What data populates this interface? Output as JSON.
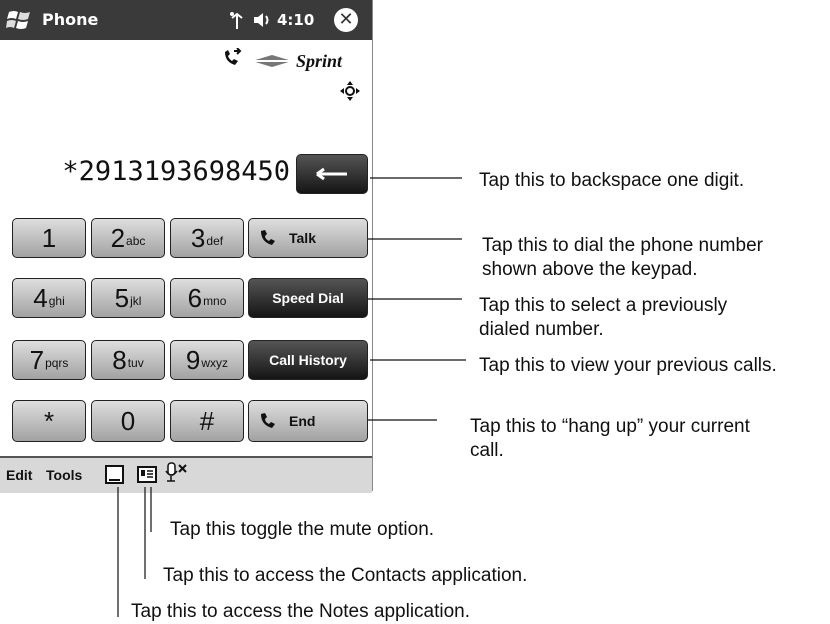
{
  "window": {
    "title": "Phone",
    "time": "4:10",
    "close_label": "✕",
    "carrier_logo": "Sprint",
    "icons": [
      "windows-start-icon",
      "antenna-icon",
      "speaker-icon",
      "call-forward-icon",
      "roaming-icon"
    ]
  },
  "dialer": {
    "number": "*2913193698450",
    "keys": [
      {
        "digit": "1",
        "letters": ""
      },
      {
        "digit": "2",
        "letters": "abc"
      },
      {
        "digit": "3",
        "letters": "def"
      },
      {
        "digit": "4",
        "letters": "ghi"
      },
      {
        "digit": "5",
        "letters": "jkl"
      },
      {
        "digit": "6",
        "letters": "mno"
      },
      {
        "digit": "7",
        "letters": "pqrs"
      },
      {
        "digit": "8",
        "letters": "tuv"
      },
      {
        "digit": "9",
        "letters": "wxyz"
      },
      {
        "digit": "*",
        "letters": ""
      },
      {
        "digit": "0",
        "letters": ""
      },
      {
        "digit": "#",
        "letters": ""
      }
    ],
    "talk_label": "Talk",
    "speed_dial_label": "Speed Dial",
    "call_history_label": "Call History",
    "end_label": "End"
  },
  "menubar": {
    "edit_label": "Edit",
    "tools_label": "Tools",
    "icons": [
      "notes-icon",
      "contacts-icon",
      "mute-icon"
    ]
  },
  "callouts": {
    "backspace": "Tap this to backspace one digit.",
    "talk_line1": "Tap this to dial the phone number",
    "talk_line2": "shown above the keypad.",
    "speed_dial_line1": "Tap this to select a previously",
    "speed_dial_line2": "dialed number.",
    "call_history": "Tap this to view your previous calls.",
    "end_line1": "Tap this to “hang up” your current",
    "end_line2": "call.",
    "mute": "Tap this toggle the mute option.",
    "contacts": "Tap this to access the Contacts application.",
    "notes": "Tap this to access the Notes application."
  },
  "colors": {
    "title_bar": "#3a3a3a",
    "key_light": "#c4c4c4",
    "key_dark": "#2a2a2a",
    "menu_bar": "#d8d8d8"
  }
}
